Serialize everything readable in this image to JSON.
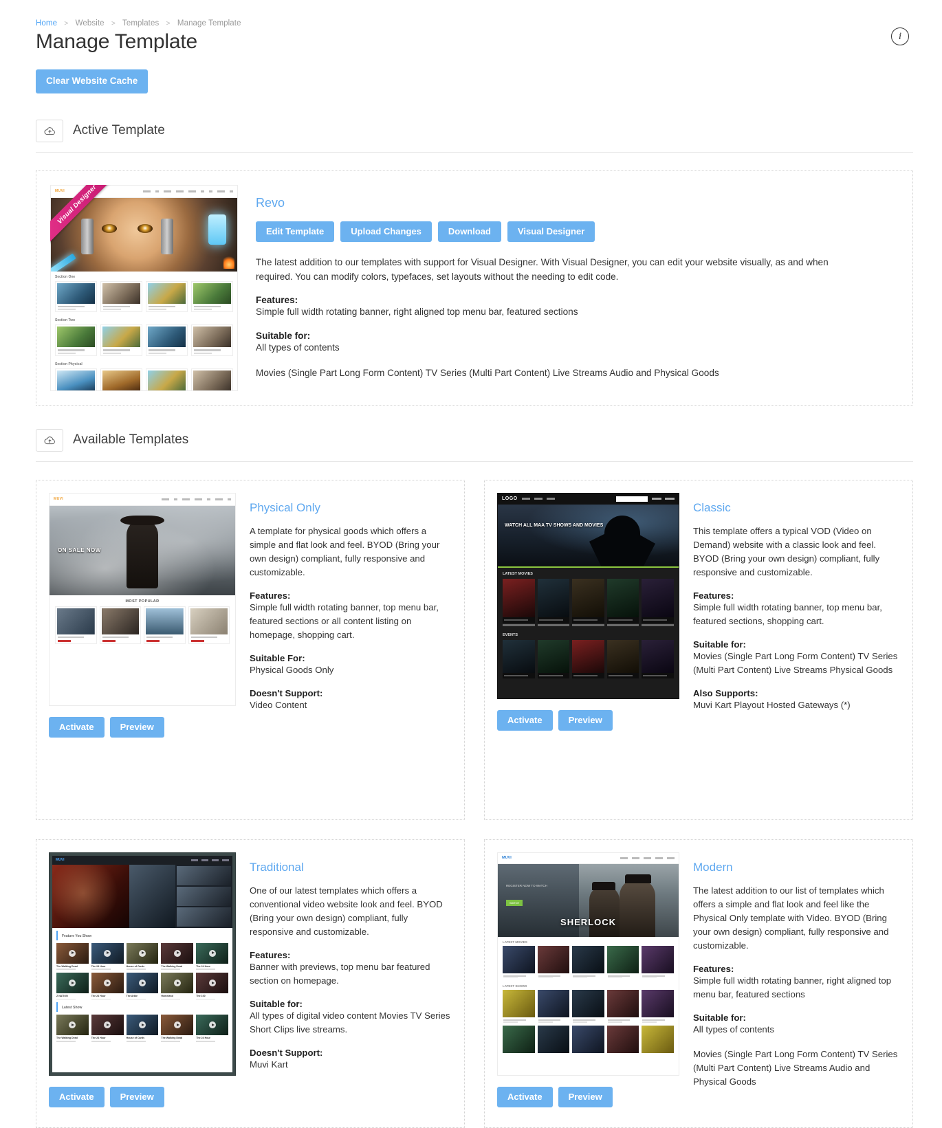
{
  "breadcrumb": {
    "items": [
      "Home",
      "Website",
      "Templates",
      "Manage Template"
    ],
    "separator": ">"
  },
  "page_title": "Manage Template",
  "info_icon_label": "i",
  "toolbar": {
    "clear_cache_label": "Clear Website Cache"
  },
  "colors": {
    "accent_blue": "#6cb2f0",
    "link_blue": "#5fa8ef",
    "ribbon_pink": "#e8348c"
  },
  "sections": {
    "active": {
      "title": "Active Template",
      "icon": "cloud-upload-icon"
    },
    "available": {
      "title": "Available Templates",
      "icon": "cloud-upload-icon"
    }
  },
  "active_template": {
    "name": "Revo",
    "ribbon": "Visual Designer",
    "buttons": [
      "Edit Template",
      "Upload Changes",
      "Download",
      "Visual Designer"
    ],
    "description": "The latest addition to our templates with support for Visual Designer. With Visual Designer, you can edit your website visually, as and when required. You can modify colors, typefaces, set layouts without the needing to edit code.",
    "features_label": "Features:",
    "features": "Simple full width rotating banner, right aligned top menu bar, featured sections",
    "suitable_label": "Suitable for:",
    "suitable": "All types of contents",
    "content_types": "Movies (Single Part Long Form Content) TV Series (Multi Part Content) Live Streams Audio and Physical Goods",
    "preview": {
      "logo": "MUVI",
      "section_one": "Section One",
      "section_two": "Section Two",
      "section_physical": "Section Physical"
    }
  },
  "available_templates": [
    {
      "name": "Physical Only",
      "description": "A template for physical goods which offers a simple and flat look and feel. BYOD (Bring your own design) compliant, fully responsive and customizable.",
      "features_label": "Features:",
      "features": "Simple full width rotating banner, top menu bar, featured sections or all content listing on homepage, shopping cart.",
      "suitable_label": "Suitable For:",
      "suitable": "Physical Goods Only",
      "extra_label": "Doesn't Support:",
      "extra": "Video Content",
      "also_label": "",
      "also": "",
      "activate_label": "Activate",
      "preview_label": "Preview",
      "preview": {
        "banner_text": "ON SALE NOW",
        "section_label": "MOST POPULAR"
      }
    },
    {
      "name": "Classic",
      "description": "This template offers a typical VOD (Video on Demand) website with a classic look and feel. BYOD (Bring your own design) compliant, fully responsive and customizable.",
      "features_label": "Features:",
      "features": "Simple full width rotating banner, top menu bar, featured sections, shopping cart.",
      "suitable_label": "Suitable for:",
      "suitable": "Movies (Single Part Long Form Content) TV Series (Multi Part Content) Live Streams Physical Goods",
      "extra_label": "",
      "extra": "",
      "also_label": "Also Supports:",
      "also": "Muvi Kart Playout Hosted Gateways (*)",
      "activate_label": "Activate",
      "preview_label": "Preview",
      "preview": {
        "logo": "LOGO",
        "banner_text": "WATCH ALL MAA TV SHOWS AND MOVIES",
        "section_label": "LATEST MOVIES",
        "section_label2": "EVENTS"
      }
    },
    {
      "name": "Traditional",
      "description": "One of our latest templates which offers a conventional video website look and feel. BYOD (Bring your own design) compliant, fully responsive and customizable.",
      "features_label": "Features:",
      "features": "Banner with previews, top menu bar featured section on homepage.",
      "suitable_label": "Suitable for:",
      "suitable": "All types of digital video content Movies TV Series Short Clips live streams.",
      "extra_label": "Doesn't Support:",
      "extra": "Muvi Kart",
      "also_label": "",
      "also": "",
      "activate_label": "Activate",
      "preview_label": "Preview",
      "preview": {
        "section_label": "Feature You Show",
        "section_label2": "Latest Show"
      }
    },
    {
      "name": "Modern",
      "description": "The latest addition to our list of templates which offers a simple and flat look and feel like the Physical Only template with Video. BYOD (Bring your own design) compliant, fully responsive and customizable.",
      "features_label": "Features:",
      "features": "Simple full width rotating banner, right aligned top menu bar, featured sections",
      "suitable_label": "Suitable for:",
      "suitable": "All types of contents",
      "extra_label": "",
      "extra": "",
      "also_label": "",
      "also": "",
      "content_types": "Movies (Single Part Long Form Content) TV Series (Multi Part Content) Live Streams Audio and Physical Goods",
      "activate_label": "Activate",
      "preview_label": "Preview",
      "preview": {
        "banner_text": "SHERLOCK"
      }
    }
  ]
}
